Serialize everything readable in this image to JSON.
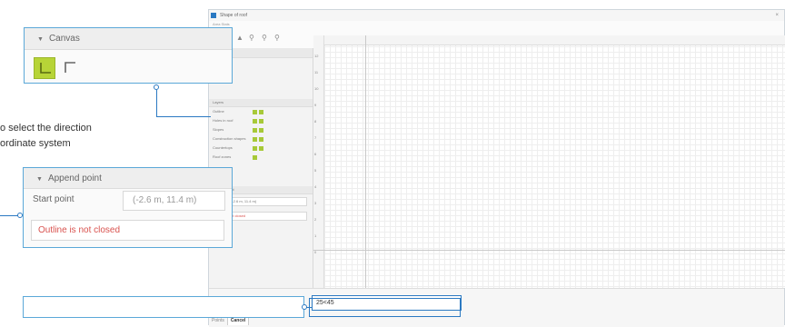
{
  "app": {
    "title": "Shape of roof",
    "menu": "Area Stats",
    "close_symbol": "×",
    "toolbar_icons": [
      "undo-icon",
      "zoom-in-icon",
      "zoom-out-icon",
      "zoom-fit-icon"
    ],
    "left_panel": {
      "point_editing": "Point editing",
      "layers_title": "Layers",
      "layers": [
        "Outline",
        "Holes in roof",
        "Slopes",
        "Construction shapes",
        "Countertops",
        "Roof zones"
      ],
      "editing": "Editing",
      "append_point": "Append point",
      "start_value": "(-2.6 m, 11.4 m)",
      "error": "Outline not closed"
    },
    "ruler_numbers": [
      "12",
      "11",
      "10",
      "9",
      "8",
      "7",
      "6",
      "5",
      "4",
      "3",
      "2",
      "1",
      "0"
    ],
    "bottom_tabs": [
      "Points",
      "Cancel"
    ],
    "input_value": "25<45"
  },
  "canvas_callout": {
    "header": "Canvas"
  },
  "note": {
    "line1": "o select the direction",
    "line2": "ordinate system"
  },
  "append_callout": {
    "header": "Append point",
    "start_label": "Start point",
    "start_value": "(-2.6 m, 11.4 m)",
    "error": "Outline is not closed"
  },
  "colors": {
    "accent": "#2b79c2",
    "selected": "#b7d437",
    "error": "#d9534f"
  }
}
